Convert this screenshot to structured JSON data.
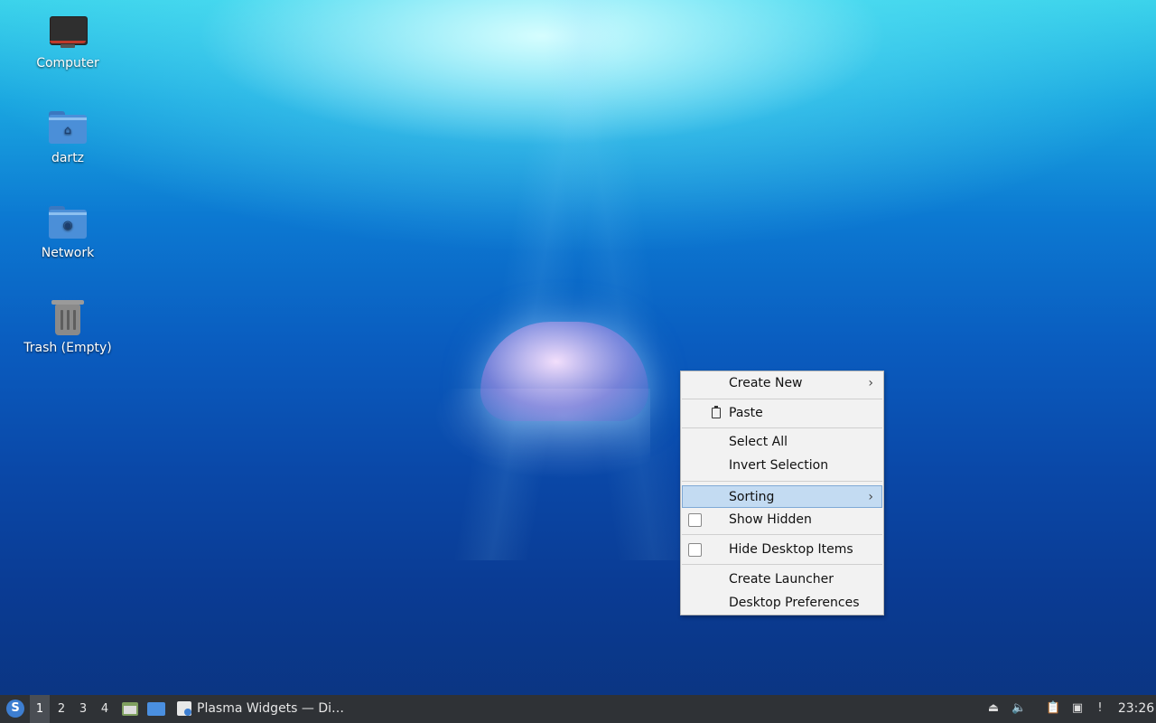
{
  "desktop": {
    "icons": [
      {
        "label": "Computer",
        "icon": "computer-icon"
      },
      {
        "label": "dartz",
        "icon": "home-folder-icon"
      },
      {
        "label": "Network",
        "icon": "network-folder-icon"
      },
      {
        "label": "Trash (Empty)",
        "icon": "trash-icon"
      }
    ]
  },
  "context_menu": {
    "create_new": "Create New",
    "paste": "Paste",
    "select_all": "Select All",
    "invert_selection": "Invert Selection",
    "sorting": "Sorting",
    "show_hidden": "Show Hidden",
    "hide_desktop_items": "Hide Desktop Items",
    "create_launcher": "Create Launcher",
    "desktop_preferences": "Desktop Preferences",
    "submenu_arrow": "›",
    "highlight_color": "#c3dbf2"
  },
  "taskbar": {
    "workspaces": [
      "1",
      "2",
      "3",
      "4"
    ],
    "active_workspace": "1",
    "task_title": "Plasma Widgets — Di…",
    "clock": "23:26",
    "background_color": "#2f3236"
  }
}
